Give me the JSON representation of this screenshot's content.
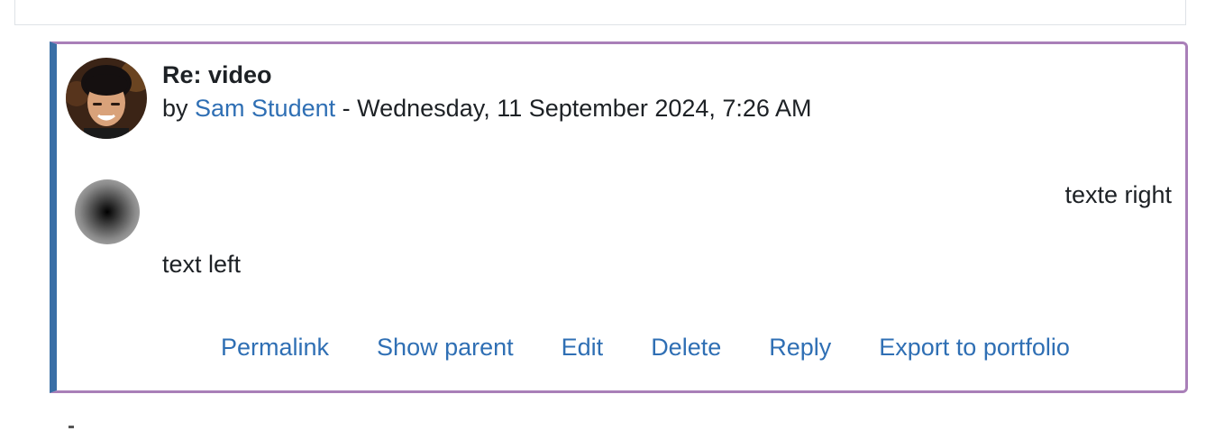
{
  "post": {
    "subject": "Re: video",
    "by_prefix": "by ",
    "author": "Sam Student",
    "date_separator": " - ",
    "date": "Wednesday, 11 September 2024, 7:26 AM",
    "text_right": "texte right",
    "text_left": "text left"
  },
  "actions": {
    "permalink": "Permalink",
    "show_parent": "Show parent",
    "edit": "Edit",
    "delete": "Delete",
    "reply": "Reply",
    "export": "Export to portfolio"
  },
  "colors": {
    "link": "#2f6fb4",
    "left_border": "#3a6fa6",
    "post_border": "#a97fb8"
  }
}
